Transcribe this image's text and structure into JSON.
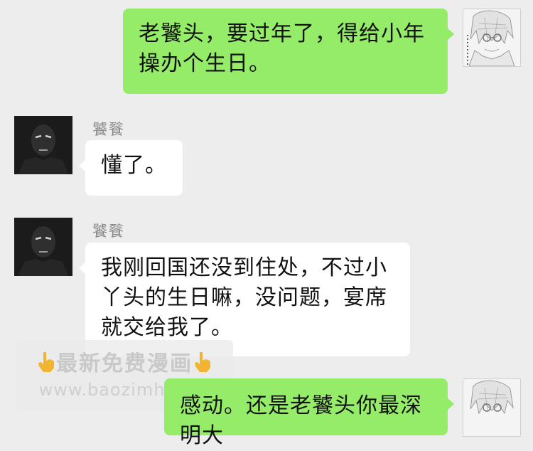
{
  "messages": [
    {
      "side": "right",
      "text": "老饕头，要过年了，得给小年\n操办个生日。"
    },
    {
      "side": "left",
      "sender": "饕餮",
      "text": "懂了。"
    },
    {
      "side": "left",
      "sender": "饕餮",
      "text": "我刚回国还没到住处，不过小\n丫头的生日嘛，没问题，宴席\n就交给我了。"
    },
    {
      "side": "right",
      "text": "感动。还是老饕头你最深明大"
    }
  ],
  "watermark": {
    "line1": "最新免费漫画",
    "line2": "www.baozimh.com",
    "icon": "pointing-hand-icon"
  },
  "colors": {
    "background": "#ededed",
    "self_bubble": "#95ec69",
    "other_bubble": "#ffffff"
  }
}
